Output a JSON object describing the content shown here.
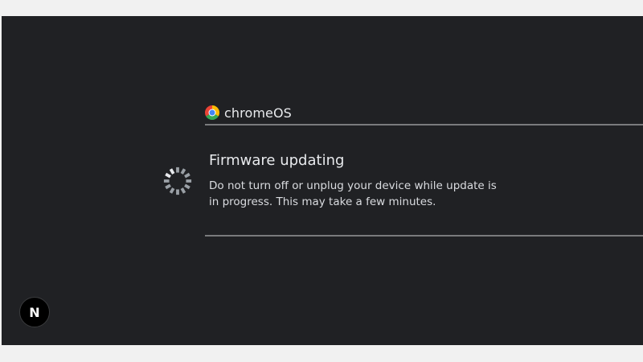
{
  "brand": {
    "name": "chromeOS",
    "logo_icon": "chrome-logo-icon"
  },
  "status": {
    "title": "Firmware updating",
    "message": "Do not turn off or unplug your device while update is in progress. This may take a few minutes.",
    "spinner_icon": "loading-spinner-icon"
  },
  "overlay_button": {
    "label": "N"
  },
  "colors": {
    "background": "#202124",
    "text": "#e8eaed",
    "divider": "#7a7b7d",
    "spinner": "#9aa0a6"
  }
}
